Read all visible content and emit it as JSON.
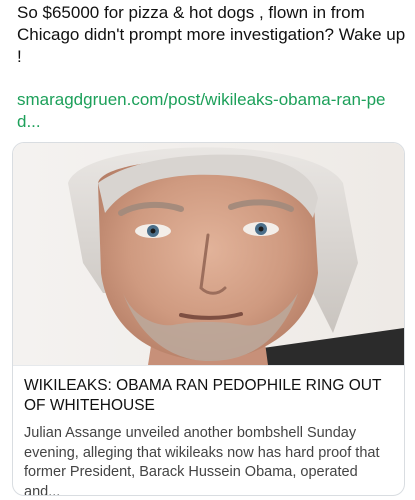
{
  "post": {
    "text": "So $65000 for pizza & hot dogs , flown in from Chicago didn't prompt more investigation? Wake up !",
    "link": "smaragdgruen.com/post/wikileaks-obama-ran-ped..."
  },
  "card": {
    "image_alt": "portrait",
    "title": "WIKILEAKS: OBAMA RAN PEDOPHILE RING OUT OF WHITEHOUSE",
    "description": "Julian Assange unveiled another bombshell Sunday evening, alleging  that wikileaks now has hard proof that former President, Barack Hussein  Obama, operated and..."
  },
  "colors": {
    "link": "#1da05a",
    "text": "#111111",
    "muted": "#444444",
    "border": "#d9dde1"
  }
}
